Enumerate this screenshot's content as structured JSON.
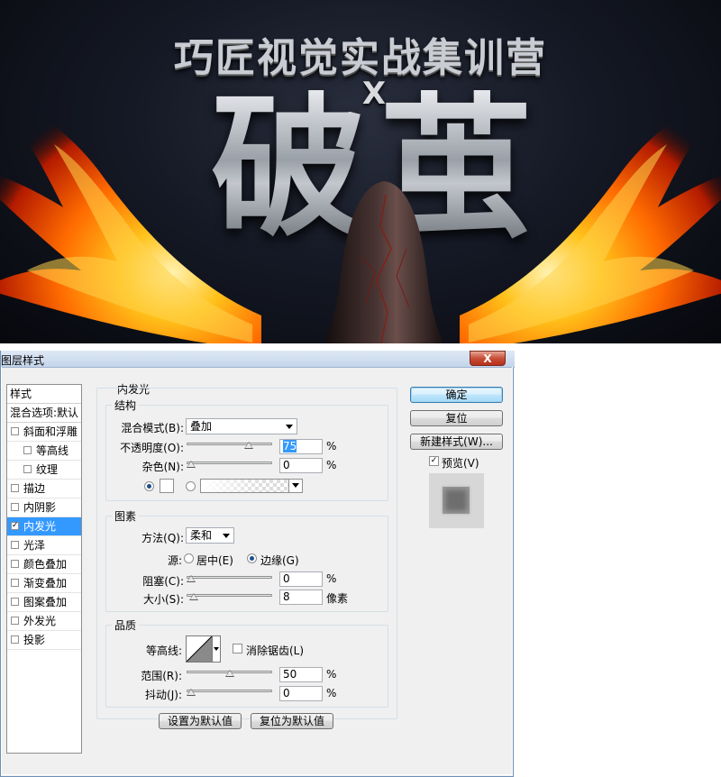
{
  "banner": {
    "headline": "巧匠视觉实战集训营",
    "cross": "X",
    "big_char_1": "破",
    "big_char_2": "茧"
  },
  "dialog": {
    "title": "图层样式",
    "close_label": "X",
    "style_list": {
      "header": "样式",
      "blend_options": "混合选项:默认",
      "items": [
        {
          "label": "斜面和浮雕",
          "checked": false,
          "level": 1
        },
        {
          "label": "等高线",
          "checked": false,
          "level": 2
        },
        {
          "label": "纹理",
          "checked": false,
          "level": 2
        },
        {
          "label": "描边",
          "checked": false,
          "level": 1
        },
        {
          "label": "内阴影",
          "checked": false,
          "level": 1
        },
        {
          "label": "内发光",
          "checked": true,
          "level": 1,
          "selected": true
        },
        {
          "label": "光泽",
          "checked": false,
          "level": 1
        },
        {
          "label": "颜色叠加",
          "checked": false,
          "level": 1
        },
        {
          "label": "渐变叠加",
          "checked": false,
          "level": 1
        },
        {
          "label": "图案叠加",
          "checked": false,
          "level": 1
        },
        {
          "label": "外发光",
          "checked": false,
          "level": 1
        },
        {
          "label": "投影",
          "checked": false,
          "level": 1
        }
      ]
    },
    "panel_title": "内发光",
    "structure": {
      "legend": "结构",
      "blend_mode_label": "混合模式(B):",
      "blend_mode_value": "叠加",
      "opacity_label": "不透明度(O):",
      "opacity_value": "75",
      "opacity_level": 75,
      "noise_label": "杂色(N):",
      "noise_value": "0",
      "noise_level": 0,
      "unit": "%"
    },
    "elements": {
      "legend": "图素",
      "technique_label": "方法(Q):",
      "technique_value": "柔和",
      "source_label": "源:",
      "source_center": "居中(E)",
      "source_edge": "边缘(G)",
      "choke_label": "阻塞(C):",
      "choke_value": "0",
      "choke_level": 0,
      "size_label": "大小(S):",
      "size_value": "8",
      "size_unit": "像素",
      "size_level": 8
    },
    "quality": {
      "legend": "品质",
      "contour_label": "等高线:",
      "antialias_label": "消除锯齿(L)",
      "range_label": "范围(R):",
      "range_value": "50",
      "range_level": 50,
      "jitter_label": "抖动(J):",
      "jitter_value": "0",
      "jitter_level": 0
    },
    "make_default": "设置为默认值",
    "reset_default": "复位为默认值",
    "ok": "确定",
    "reset": "复位",
    "new_style": "新建样式(W)...",
    "preview_label": "预览(V)",
    "preview_checked": true
  }
}
